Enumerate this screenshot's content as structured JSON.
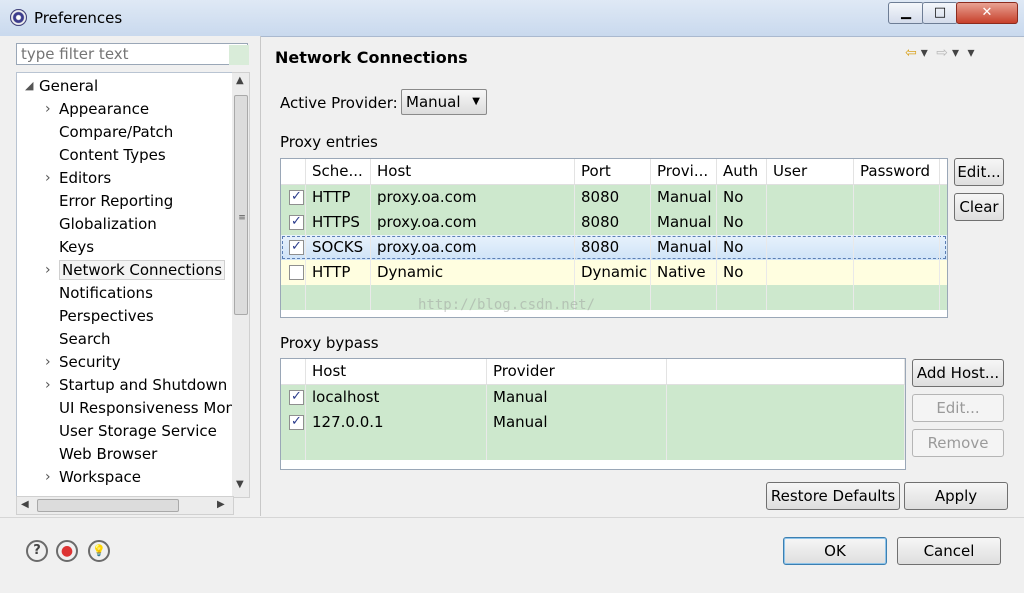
{
  "window": {
    "title": "Preferences"
  },
  "sidebar": {
    "filter_placeholder": "type filter text",
    "items": [
      {
        "label": "General",
        "level": 0,
        "expanded": true
      },
      {
        "label": "Appearance",
        "level": 1,
        "has_children": true
      },
      {
        "label": "Compare/Patch",
        "level": 1
      },
      {
        "label": "Content Types",
        "level": 1
      },
      {
        "label": "Editors",
        "level": 1,
        "has_children": true
      },
      {
        "label": "Error Reporting",
        "level": 1
      },
      {
        "label": "Globalization",
        "level": 1
      },
      {
        "label": "Keys",
        "level": 1
      },
      {
        "label": "Network Connections",
        "level": 1,
        "has_children": true,
        "selected": true
      },
      {
        "label": "Notifications",
        "level": 1
      },
      {
        "label": "Perspectives",
        "level": 1
      },
      {
        "label": "Search",
        "level": 1
      },
      {
        "label": "Security",
        "level": 1,
        "has_children": true
      },
      {
        "label": "Startup and Shutdown",
        "level": 1,
        "has_children": true
      },
      {
        "label": "UI Responsiveness Mon",
        "level": 1
      },
      {
        "label": "User Storage Service",
        "level": 1
      },
      {
        "label": "Web Browser",
        "level": 1
      },
      {
        "label": "Workspace",
        "level": 1,
        "has_children": true
      }
    ]
  },
  "main": {
    "title": "Network Connections",
    "active_provider_label": "Active Provider:",
    "active_provider_value": "Manual",
    "proxy_entries_label": "Proxy entries",
    "proxy_columns": [
      "Sche...",
      "Host",
      "Port",
      "Provi...",
      "Auth",
      "User",
      "Password"
    ],
    "proxy_rows": [
      {
        "checked": true,
        "cells": [
          "HTTP",
          "proxy.oa.com",
          "8080",
          "Manual",
          "No",
          "",
          ""
        ],
        "style": "green"
      },
      {
        "checked": true,
        "cells": [
          "HTTPS",
          "proxy.oa.com",
          "8080",
          "Manual",
          "No",
          "",
          ""
        ],
        "style": "green"
      },
      {
        "checked": true,
        "cells": [
          "SOCKS",
          "proxy.oa.com",
          "8080",
          "Manual",
          "No",
          "",
          ""
        ],
        "style": "selected"
      },
      {
        "checked": false,
        "cells": [
          "HTTP",
          "Dynamic",
          "Dynamic",
          "Native",
          "No",
          "",
          ""
        ],
        "style": "yellow"
      }
    ],
    "proxy_buttons": {
      "edit": "Edit...",
      "clear": "Clear"
    },
    "proxy_bypass_label": "Proxy bypass",
    "bypass_columns": [
      "Host",
      "Provider"
    ],
    "bypass_rows": [
      {
        "checked": true,
        "cells": [
          "localhost",
          "Manual"
        ]
      },
      {
        "checked": true,
        "cells": [
          "127.0.0.1",
          "Manual"
        ]
      }
    ],
    "bypass_buttons": {
      "add_host": "Add Host...",
      "edit": "Edit...",
      "remove": "Remove"
    },
    "restore_defaults": "Restore Defaults",
    "apply": "Apply",
    "watermark": "http://blog.csdn.net/"
  },
  "footer": {
    "ok": "OK",
    "cancel": "Cancel"
  },
  "icons": {
    "help": "?",
    "record": "●",
    "tip": "bulb",
    "check": "✓"
  }
}
